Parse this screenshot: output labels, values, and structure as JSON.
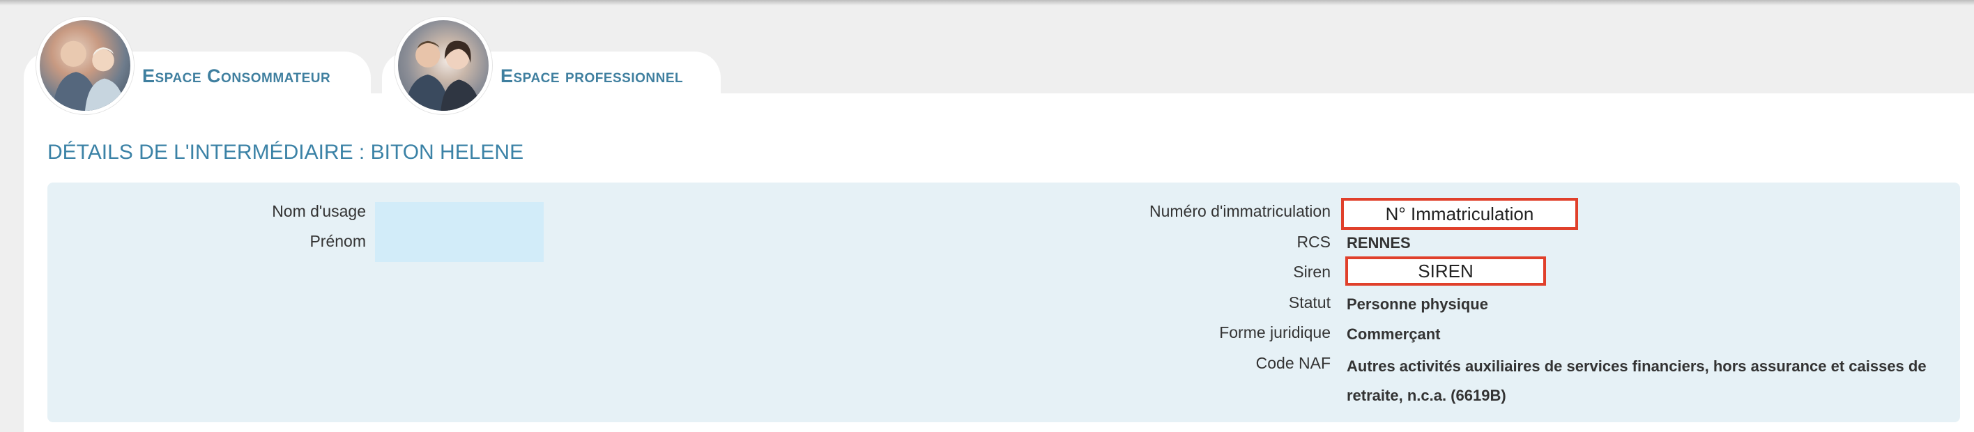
{
  "tabs": [
    {
      "label": "Espace Consommateur",
      "image": "consumer-avatar"
    },
    {
      "label": "Espace professionnel",
      "image": "professional-avatar"
    }
  ],
  "page": {
    "title": "DÉTAILS DE L'INTERMÉDIAIRE :  BITON HELENE"
  },
  "details": {
    "nom_usage_label": "Nom d'usage",
    "prenom_label": "Prénom",
    "immat_label": "Numéro d'immatriculation",
    "immat_value": "N° Immatriculation",
    "rcs_label": "RCS",
    "rcs_value": "RENNES",
    "siren_label": "Siren",
    "siren_value": "SIREN",
    "statut_label": "Statut",
    "statut_value": "Personne physique",
    "forme_label": "Forme juridique",
    "forme_value": "Commerçant",
    "naf_label": "Code NAF",
    "naf_value": "Autres activités auxiliaires de services financiers, hors assurance et caisses de retraite, n.c.a. (6619B)"
  },
  "colors": {
    "accent": "#3b82a6",
    "box_background": "#e6f1f6",
    "highlight_border": "#e0402b",
    "redacted_field": "#d2ecf9"
  }
}
